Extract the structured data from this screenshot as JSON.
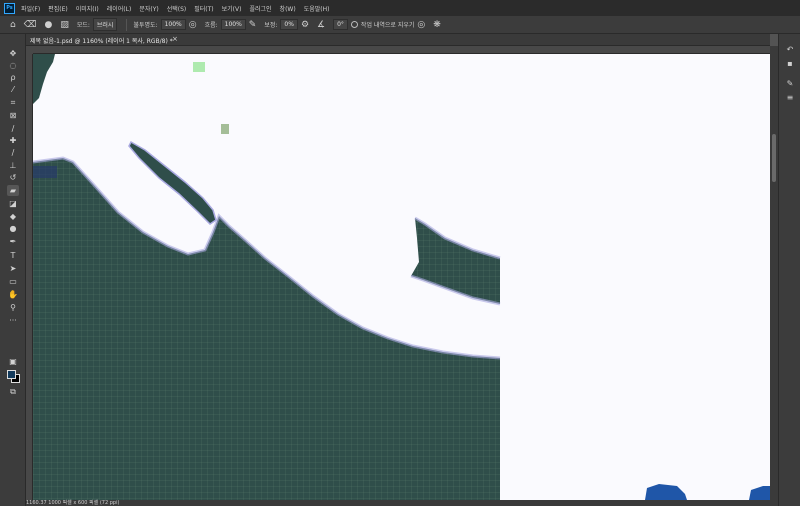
{
  "app": {
    "logo": "Ps"
  },
  "menu": [
    "파일(F)",
    "편집(E)",
    "이미지(I)",
    "레이어(L)",
    "문자(Y)",
    "선택(S)",
    "필터(T)",
    "보기(V)",
    "플러그인",
    "창(W)",
    "도움말(H)"
  ],
  "options": {
    "mode_label": "모드:",
    "mode_value": "브러시",
    "opacity_label": "불투명도:",
    "opacity_value": "100%",
    "flow_label": "흐름:",
    "flow_value": "100%",
    "smoothing_label": "보정:",
    "smoothing_value": "0%",
    "angle_value": "0°",
    "erase_history_label": "작업 내역으로 지우기"
  },
  "document": {
    "tab_title": "제목 없음-1.psd @ 1160% (레이어 1 복사, RGB/8) *",
    "close_glyph": "×"
  },
  "status": {
    "text": "1160.37  1000 픽셀 x 600 픽셀 (72 ppi)"
  },
  "colors": {
    "foreground": "#123a5c",
    "background": "#000000",
    "ink": "#2f4e4a",
    "canvas": "#fafafe"
  },
  "tools": [
    "move-icon",
    "marquee-icon",
    "lasso-icon",
    "magic-wand-icon",
    "crop-icon",
    "frame-icon",
    "eyedropper-icon",
    "healing-icon",
    "brush-icon",
    "stamp-icon",
    "history-brush-icon",
    "eraser-icon",
    "gradient-icon",
    "blur-icon",
    "dodge-icon",
    "pen-icon",
    "type-icon",
    "path-select-icon",
    "rectangle-icon",
    "hand-icon",
    "zoom-icon",
    "more-tools-icon"
  ]
}
